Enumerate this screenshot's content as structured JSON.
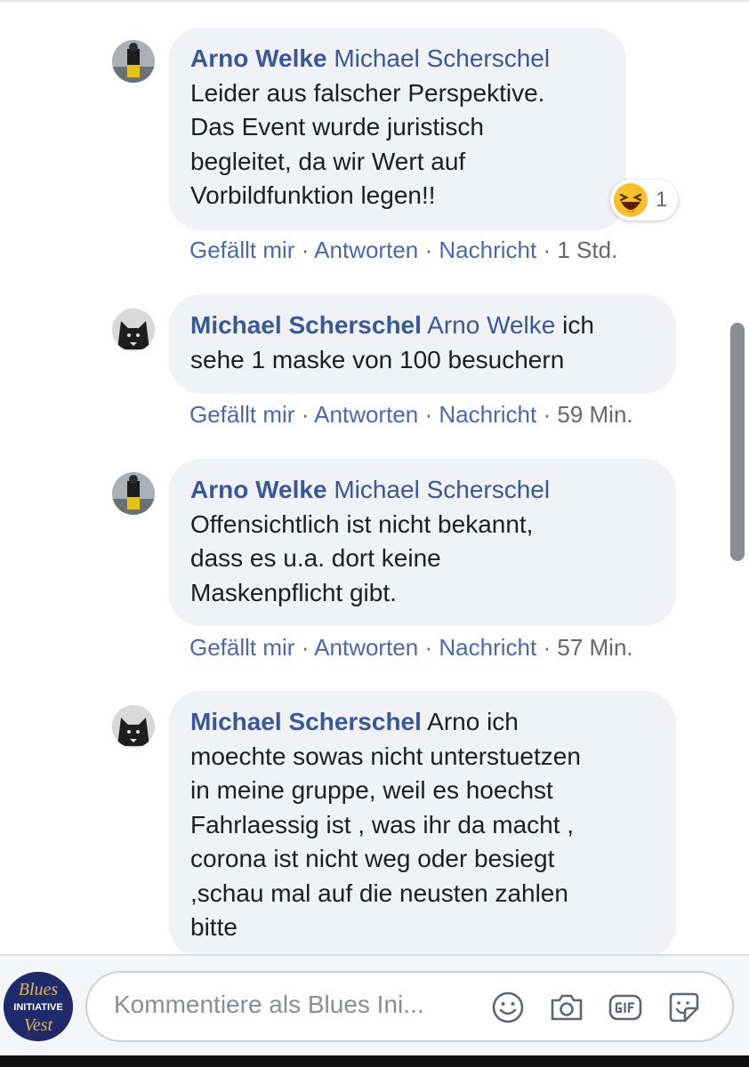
{
  "comments": [
    {
      "author": "Arno Welke",
      "mention": "Michael Scherschel",
      "lines": [
        "Leider aus falscher Perspektive.",
        "Das Event wurde juristisch",
        "begleitet, da wir Wert auf",
        "Vorbildfunktion legen!!"
      ],
      "reaction": {
        "icon": "haha-emoji-icon",
        "count": "1"
      },
      "actions": {
        "like": "Gefällt mir",
        "reply": "Antworten",
        "message": "Nachricht",
        "time": "1 Std."
      }
    },
    {
      "author": "Michael Scherschel",
      "mention": "Arno Welke",
      "first_line_rest": " ich",
      "lines": [
        "sehe 1 maske von 100 besuchern"
      ],
      "actions": {
        "like": "Gefällt mir",
        "reply": "Antworten",
        "message": "Nachricht",
        "time": "59 Min."
      }
    },
    {
      "author": "Arno Welke",
      "mention": "Michael Scherschel",
      "lines": [
        "Offensichtlich ist nicht bekannt,",
        "dass es u.a. dort keine",
        "Maskenpflicht gibt."
      ],
      "actions": {
        "like": "Gefällt mir",
        "reply": "Antworten",
        "message": "Nachricht",
        "time": "57 Min."
      }
    },
    {
      "author": "Michael Scherschel",
      "first_line_rest": " Arno ich",
      "lines": [
        "moechte sowas nicht unterstuetzen",
        "in meine gruppe, weil es hoechst",
        "Fahrlaessig ist , was ihr da macht ,",
        "corona ist nicht weg oder besiegt",
        ",schau mal auf die neusten zahlen",
        "bitte"
      ]
    }
  ],
  "separator": "·",
  "composer": {
    "placeholder": "Kommentiere als Blues Ini...",
    "page_logo": {
      "line1": "Blues",
      "line2": "INITIATIVE",
      "line3": "Vest"
    },
    "tools": [
      "emoji-icon",
      "camera-icon",
      "gif-icon",
      "sticker-icon"
    ]
  },
  "colors": {
    "link": "#385898",
    "bubble": "#f0f2f5",
    "meta": "#65676b"
  }
}
